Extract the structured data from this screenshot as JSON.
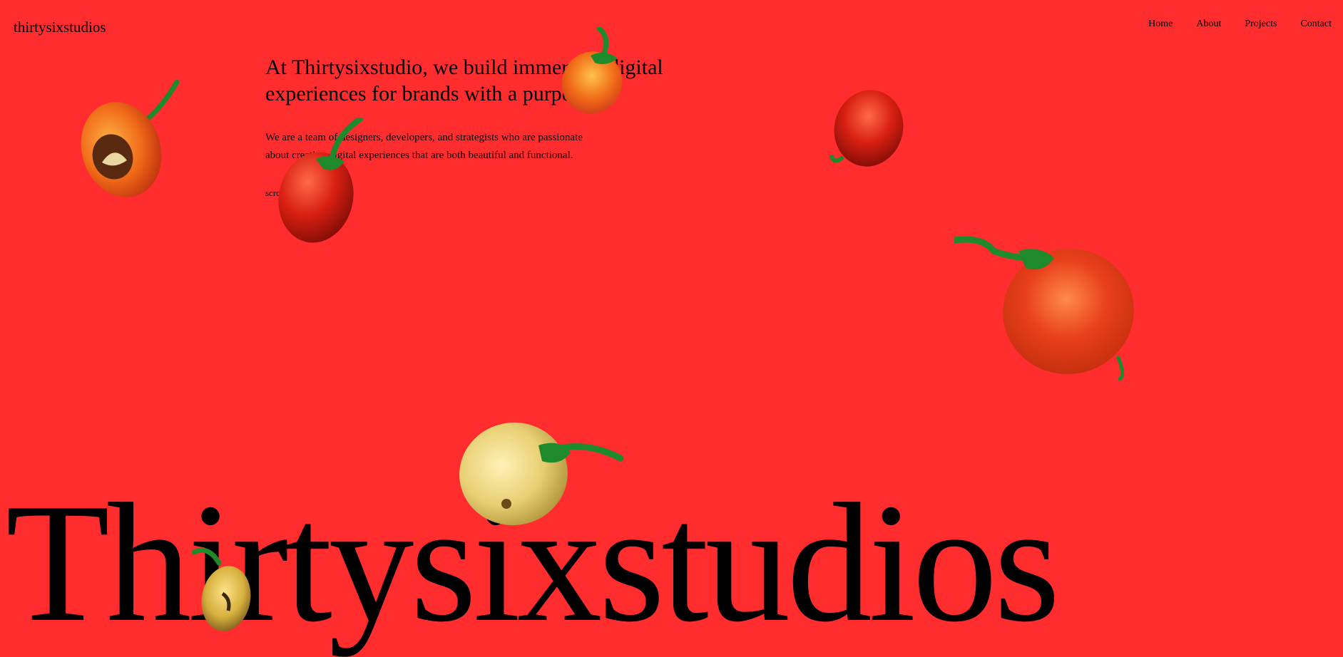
{
  "header": {
    "logo": "thirtysixstudios",
    "nav": [
      "Home",
      "About",
      "Projects",
      "Contact"
    ]
  },
  "hero": {
    "headline": "At Thirtysixstudio, we build immersive digital experiences for brands with a purpose.",
    "body": "We are a team of designers, developers, and strategists who are passionate about creating digital experiences that are both beautiful and functional.",
    "scroll": "scroll",
    "big_title": "Thirtysixstudios"
  },
  "colors": {
    "background": "#ff2d2d",
    "text": "#000000",
    "pepper_red": "#d81f12",
    "pepper_orange": "#f06a18",
    "pepper_yellow": "#e8cf73",
    "stem_green": "#1e8a2c"
  }
}
